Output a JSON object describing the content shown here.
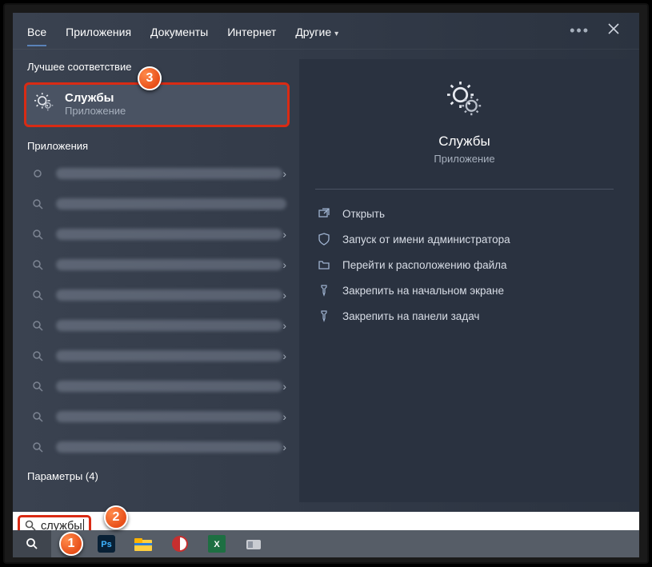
{
  "tabs": {
    "all": "Все",
    "apps": "Приложения",
    "docs": "Документы",
    "internet": "Интернет",
    "other": "Другие"
  },
  "sections": {
    "best_match": "Лучшее соответствие",
    "apps": "Приложения",
    "settings": "Параметры (4)"
  },
  "best_match": {
    "title": "Службы",
    "subtitle": "Приложение"
  },
  "preview": {
    "title": "Службы",
    "subtitle": "Приложение"
  },
  "actions": {
    "open": "Открыть",
    "run_admin": "Запуск от имени администратора",
    "open_location": "Перейти к расположению файла",
    "pin_start": "Закрепить на начальном экране",
    "pin_taskbar": "Закрепить на панели задач"
  },
  "search": {
    "query": "службы"
  },
  "badges": {
    "b1": "1",
    "b2": "2",
    "b3": "3"
  }
}
